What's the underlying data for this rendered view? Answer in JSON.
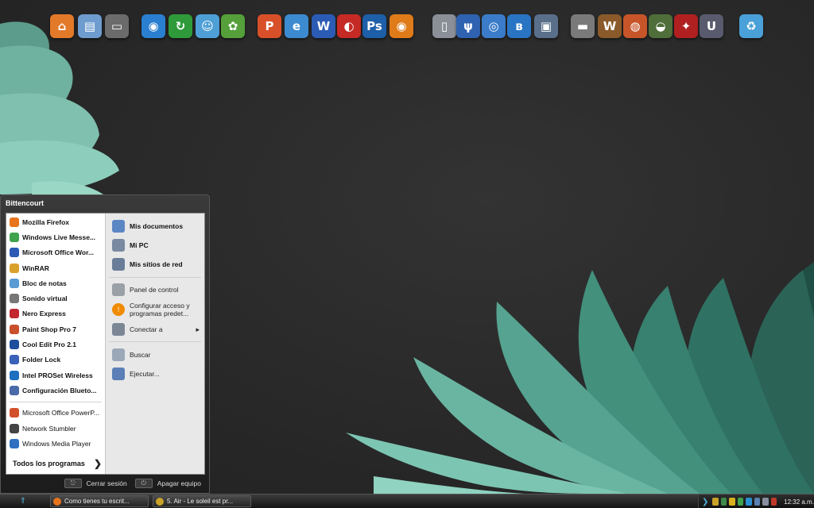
{
  "user_name": "Bittencourt",
  "pinned_programs": [
    {
      "label": "Mozilla Firefox",
      "icon": "firefox-icon",
      "color": "#e8741c"
    },
    {
      "label": "Windows Live Messe...",
      "icon": "messenger-icon",
      "color": "#3fa34d"
    },
    {
      "label": "Microsoft Office Wor...",
      "icon": "word-icon",
      "color": "#2b5bb5"
    },
    {
      "label": "WinRAR",
      "icon": "winrar-icon",
      "color": "#d9a12a"
    },
    {
      "label": "Bloc de notas",
      "icon": "notepad-icon",
      "color": "#5a9bd4"
    },
    {
      "label": "Sonido virtual",
      "icon": "virtual-sound-icon",
      "color": "#777777"
    },
    {
      "label": "Nero Express",
      "icon": "nero-icon",
      "color": "#c2262e"
    },
    {
      "label": "Paint Shop Pro 7",
      "icon": "paint-shop-icon",
      "color": "#c8502a"
    },
    {
      "label": "Cool Edit Pro 2.1",
      "icon": "cool-edit-icon",
      "color": "#1d4f9c"
    },
    {
      "label": "Folder Lock",
      "icon": "folder-lock-icon",
      "color": "#3a62b8"
    },
    {
      "label": "Intel PROSet Wireless",
      "icon": "intel-wireless-icon",
      "color": "#1f6fc1"
    },
    {
      "label": "Configuración Blueto...",
      "icon": "bluetooth-icon",
      "color": "#4a6aa8"
    }
  ],
  "recent_programs": [
    {
      "label": "Microsoft Office PowerP...",
      "icon": "powerpoint-icon",
      "color": "#d2502a"
    },
    {
      "label": "Network Stumbler",
      "icon": "network-stumbler-icon",
      "color": "#444444"
    },
    {
      "label": "Windows Media Player",
      "icon": "media-player-icon",
      "color": "#2f6fbf"
    }
  ],
  "all_programs_label": "Todos los programas",
  "places": [
    {
      "label": "Mis documentos",
      "icon": "my-documents-icon",
      "color": "#5b86c4"
    },
    {
      "label": "Mi PC",
      "icon": "my-computer-icon",
      "color": "#7a8aa0"
    },
    {
      "label": "Mis sitios de red",
      "icon": "network-places-icon",
      "color": "#6a7d98"
    }
  ],
  "system_links": [
    {
      "label": "Panel de control",
      "icon": "control-panel-icon",
      "color": "#9aa0a8"
    },
    {
      "label": "Configurar acceso y",
      "label2": "programas predet...",
      "icon": "set-defaults-icon",
      "color": "#f08a00"
    },
    {
      "label": "Conectar a",
      "icon": "connect-to-icon",
      "color": "#7c8796"
    }
  ],
  "tool_links": [
    {
      "label": "Buscar",
      "icon": "search-icon",
      "color": "#9aa8b8"
    },
    {
      "label": "Ejecutar...",
      "icon": "run-icon",
      "color": "#5b7fb6"
    }
  ],
  "footer": {
    "logoff_label": "Cerrar sesión",
    "shutdown_label": "Apagar equipo"
  },
  "taskbar": {
    "tasks": [
      {
        "label": "Como tienes tu escrit...",
        "color": "#e8741c"
      },
      {
        "label": "5. Air - Le soleil est pr...",
        "color": "#c9a227"
      }
    ],
    "clock": "12:32 a.m."
  },
  "dock_icons": [
    {
      "name": "home-icon",
      "color": "#e27a2a",
      "glyph": "⌂"
    },
    {
      "name": "documents-icon",
      "color": "#6e9ccf",
      "glyph": "▤"
    },
    {
      "name": "pda-icon",
      "color": "#6b6b6b",
      "glyph": "▭"
    },
    {
      "name": "globe-icon",
      "color": "#2a7fd0",
      "glyph": "◉"
    },
    {
      "name": "sync-icon",
      "color": "#2f9a3a",
      "glyph": "↻"
    },
    {
      "name": "messenger-icon",
      "color": "#4e9fd6",
      "glyph": "☺"
    },
    {
      "name": "gimp-icon",
      "color": "#55a03a",
      "glyph": "✿"
    },
    {
      "name": "powerpoint-icon",
      "color": "#d8502a",
      "glyph": "P"
    },
    {
      "name": "internet-explorer-icon",
      "color": "#3c8ad0",
      "glyph": "e"
    },
    {
      "name": "word-icon",
      "color": "#2b5bb5",
      "glyph": "W"
    },
    {
      "name": "nero-icon",
      "color": "#c52a24",
      "glyph": "◐"
    },
    {
      "name": "photoshop-icon",
      "color": "#1d5fa8",
      "glyph": "Ps"
    },
    {
      "name": "eye-icon",
      "color": "#e07b1a",
      "glyph": "◉"
    },
    {
      "name": "mobile-phone-icon",
      "color": "#8a8f98",
      "glyph": "▯"
    },
    {
      "name": "usb-icon",
      "color": "#2f62b0",
      "glyph": "ψ"
    },
    {
      "name": "sync-center-icon",
      "color": "#3a7cc9",
      "glyph": "◎"
    },
    {
      "name": "bluetooth-icon",
      "color": "#2a74c4",
      "glyph": "ʙ"
    },
    {
      "name": "network-drive-icon",
      "color": "#5a6f8a",
      "glyph": "▣"
    },
    {
      "name": "nes-console-icon",
      "color": "#7a7a7a",
      "glyph": "▬"
    },
    {
      "name": "warcraft-icon",
      "color": "#8a5a2a",
      "glyph": "W"
    },
    {
      "name": "worms-icon",
      "color": "#c8552a",
      "glyph": "◍"
    },
    {
      "name": "halo-icon",
      "color": "#4f6e3a",
      "glyph": "◒"
    },
    {
      "name": "assassin-icon",
      "color": "#b02020",
      "glyph": "✦"
    },
    {
      "name": "unreal-icon",
      "color": "#5a5a6e",
      "glyph": "U"
    },
    {
      "name": "recycle-bin-icon",
      "color": "#4aa0d8",
      "glyph": "♻"
    }
  ]
}
